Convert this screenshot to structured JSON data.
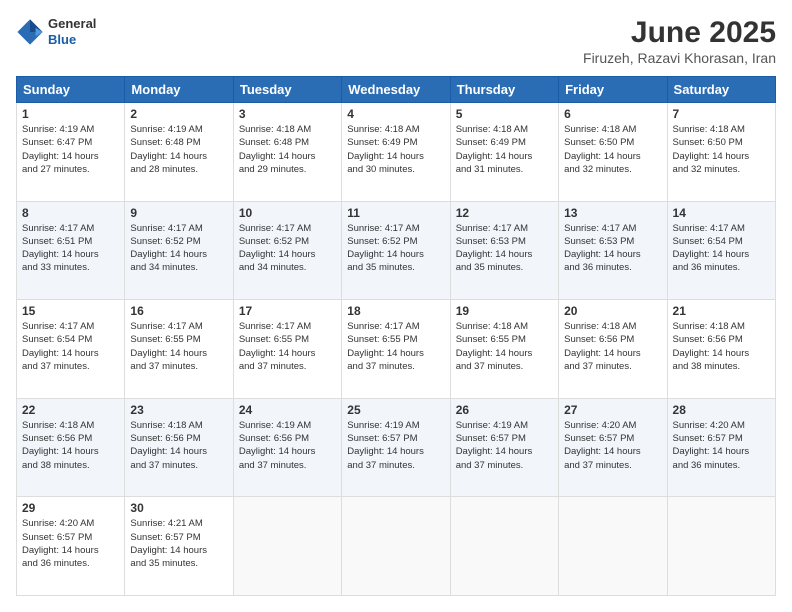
{
  "header": {
    "logo_general": "General",
    "logo_blue": "Blue",
    "month_title": "June 2025",
    "location": "Firuzeh, Razavi Khorasan, Iran"
  },
  "weekdays": [
    "Sunday",
    "Monday",
    "Tuesday",
    "Wednesday",
    "Thursday",
    "Friday",
    "Saturday"
  ],
  "weeks": [
    [
      {
        "day": "1",
        "info": "Sunrise: 4:19 AM\nSunset: 6:47 PM\nDaylight: 14 hours\nand 27 minutes."
      },
      {
        "day": "2",
        "info": "Sunrise: 4:19 AM\nSunset: 6:48 PM\nDaylight: 14 hours\nand 28 minutes."
      },
      {
        "day": "3",
        "info": "Sunrise: 4:18 AM\nSunset: 6:48 PM\nDaylight: 14 hours\nand 29 minutes."
      },
      {
        "day": "4",
        "info": "Sunrise: 4:18 AM\nSunset: 6:49 PM\nDaylight: 14 hours\nand 30 minutes."
      },
      {
        "day": "5",
        "info": "Sunrise: 4:18 AM\nSunset: 6:49 PM\nDaylight: 14 hours\nand 31 minutes."
      },
      {
        "day": "6",
        "info": "Sunrise: 4:18 AM\nSunset: 6:50 PM\nDaylight: 14 hours\nand 32 minutes."
      },
      {
        "day": "7",
        "info": "Sunrise: 4:18 AM\nSunset: 6:50 PM\nDaylight: 14 hours\nand 32 minutes."
      }
    ],
    [
      {
        "day": "8",
        "info": "Sunrise: 4:17 AM\nSunset: 6:51 PM\nDaylight: 14 hours\nand 33 minutes."
      },
      {
        "day": "9",
        "info": "Sunrise: 4:17 AM\nSunset: 6:52 PM\nDaylight: 14 hours\nand 34 minutes."
      },
      {
        "day": "10",
        "info": "Sunrise: 4:17 AM\nSunset: 6:52 PM\nDaylight: 14 hours\nand 34 minutes."
      },
      {
        "day": "11",
        "info": "Sunrise: 4:17 AM\nSunset: 6:52 PM\nDaylight: 14 hours\nand 35 minutes."
      },
      {
        "day": "12",
        "info": "Sunrise: 4:17 AM\nSunset: 6:53 PM\nDaylight: 14 hours\nand 35 minutes."
      },
      {
        "day": "13",
        "info": "Sunrise: 4:17 AM\nSunset: 6:53 PM\nDaylight: 14 hours\nand 36 minutes."
      },
      {
        "day": "14",
        "info": "Sunrise: 4:17 AM\nSunset: 6:54 PM\nDaylight: 14 hours\nand 36 minutes."
      }
    ],
    [
      {
        "day": "15",
        "info": "Sunrise: 4:17 AM\nSunset: 6:54 PM\nDaylight: 14 hours\nand 37 minutes."
      },
      {
        "day": "16",
        "info": "Sunrise: 4:17 AM\nSunset: 6:55 PM\nDaylight: 14 hours\nand 37 minutes."
      },
      {
        "day": "17",
        "info": "Sunrise: 4:17 AM\nSunset: 6:55 PM\nDaylight: 14 hours\nand 37 minutes."
      },
      {
        "day": "18",
        "info": "Sunrise: 4:17 AM\nSunset: 6:55 PM\nDaylight: 14 hours\nand 37 minutes."
      },
      {
        "day": "19",
        "info": "Sunrise: 4:18 AM\nSunset: 6:55 PM\nDaylight: 14 hours\nand 37 minutes."
      },
      {
        "day": "20",
        "info": "Sunrise: 4:18 AM\nSunset: 6:56 PM\nDaylight: 14 hours\nand 37 minutes."
      },
      {
        "day": "21",
        "info": "Sunrise: 4:18 AM\nSunset: 6:56 PM\nDaylight: 14 hours\nand 38 minutes."
      }
    ],
    [
      {
        "day": "22",
        "info": "Sunrise: 4:18 AM\nSunset: 6:56 PM\nDaylight: 14 hours\nand 38 minutes."
      },
      {
        "day": "23",
        "info": "Sunrise: 4:18 AM\nSunset: 6:56 PM\nDaylight: 14 hours\nand 37 minutes."
      },
      {
        "day": "24",
        "info": "Sunrise: 4:19 AM\nSunset: 6:56 PM\nDaylight: 14 hours\nand 37 minutes."
      },
      {
        "day": "25",
        "info": "Sunrise: 4:19 AM\nSunset: 6:57 PM\nDaylight: 14 hours\nand 37 minutes."
      },
      {
        "day": "26",
        "info": "Sunrise: 4:19 AM\nSunset: 6:57 PM\nDaylight: 14 hours\nand 37 minutes."
      },
      {
        "day": "27",
        "info": "Sunrise: 4:20 AM\nSunset: 6:57 PM\nDaylight: 14 hours\nand 37 minutes."
      },
      {
        "day": "28",
        "info": "Sunrise: 4:20 AM\nSunset: 6:57 PM\nDaylight: 14 hours\nand 36 minutes."
      }
    ],
    [
      {
        "day": "29",
        "info": "Sunrise: 4:20 AM\nSunset: 6:57 PM\nDaylight: 14 hours\nand 36 minutes."
      },
      {
        "day": "30",
        "info": "Sunrise: 4:21 AM\nSunset: 6:57 PM\nDaylight: 14 hours\nand 35 minutes."
      },
      null,
      null,
      null,
      null,
      null
    ]
  ]
}
